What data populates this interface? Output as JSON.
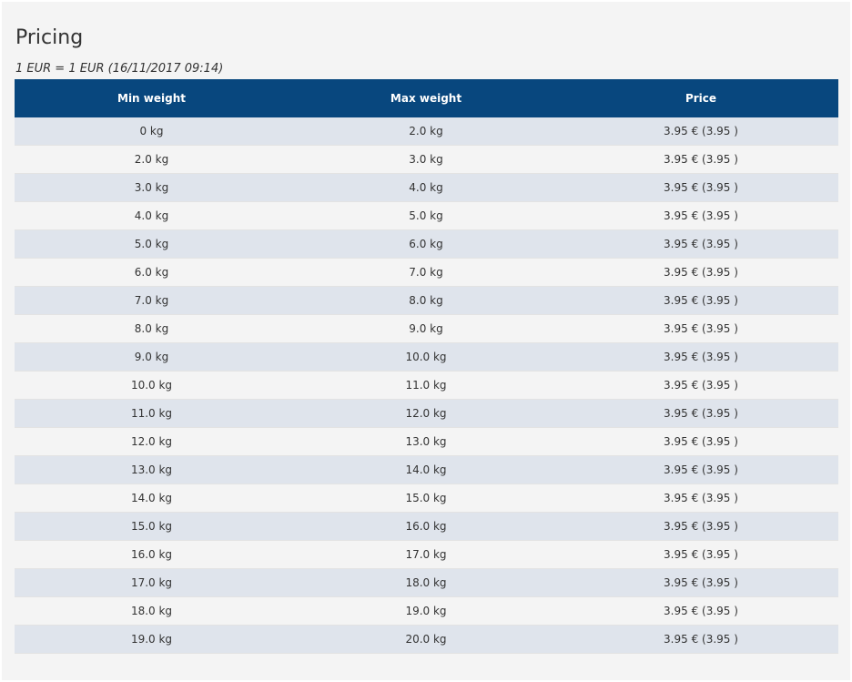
{
  "page": {
    "title": "Pricing",
    "rate_note": "1 EUR = 1 EUR (16/11/2017 09:14)"
  },
  "table": {
    "headers": [
      "Min weight",
      "Max weight",
      "Price"
    ],
    "rows": [
      [
        "0 kg",
        "2.0 kg",
        "3.95 € (3.95 )"
      ],
      [
        "2.0 kg",
        "3.0 kg",
        "3.95 € (3.95 )"
      ],
      [
        "3.0 kg",
        "4.0 kg",
        "3.95 € (3.95 )"
      ],
      [
        "4.0 kg",
        "5.0 kg",
        "3.95 € (3.95 )"
      ],
      [
        "5.0 kg",
        "6.0 kg",
        "3.95 € (3.95 )"
      ],
      [
        "6.0 kg",
        "7.0 kg",
        "3.95 € (3.95 )"
      ],
      [
        "7.0 kg",
        "8.0 kg",
        "3.95 € (3.95 )"
      ],
      [
        "8.0 kg",
        "9.0 kg",
        "3.95 € (3.95 )"
      ],
      [
        "9.0 kg",
        "10.0 kg",
        "3.95 € (3.95 )"
      ],
      [
        "10.0 kg",
        "11.0 kg",
        "3.95 € (3.95 )"
      ],
      [
        "11.0 kg",
        "12.0 kg",
        "3.95 € (3.95 )"
      ],
      [
        "12.0 kg",
        "13.0 kg",
        "3.95 € (3.95 )"
      ],
      [
        "13.0 kg",
        "14.0 kg",
        "3.95 € (3.95 )"
      ],
      [
        "14.0 kg",
        "15.0 kg",
        "3.95 € (3.95 )"
      ],
      [
        "15.0 kg",
        "16.0 kg",
        "3.95 € (3.95 )"
      ],
      [
        "16.0 kg",
        "17.0 kg",
        "3.95 € (3.95 )"
      ],
      [
        "17.0 kg",
        "18.0 kg",
        "3.95 € (3.95 )"
      ],
      [
        "18.0 kg",
        "19.0 kg",
        "3.95 € (3.95 )"
      ],
      [
        "19.0 kg",
        "20.0 kg",
        "3.95 € (3.95 )"
      ]
    ]
  },
  "colors": {
    "header_background": "#08477e",
    "header_text": "#ffffff",
    "row_alt_background": "#dfe4ec",
    "page_background": "#f4f4f4"
  }
}
